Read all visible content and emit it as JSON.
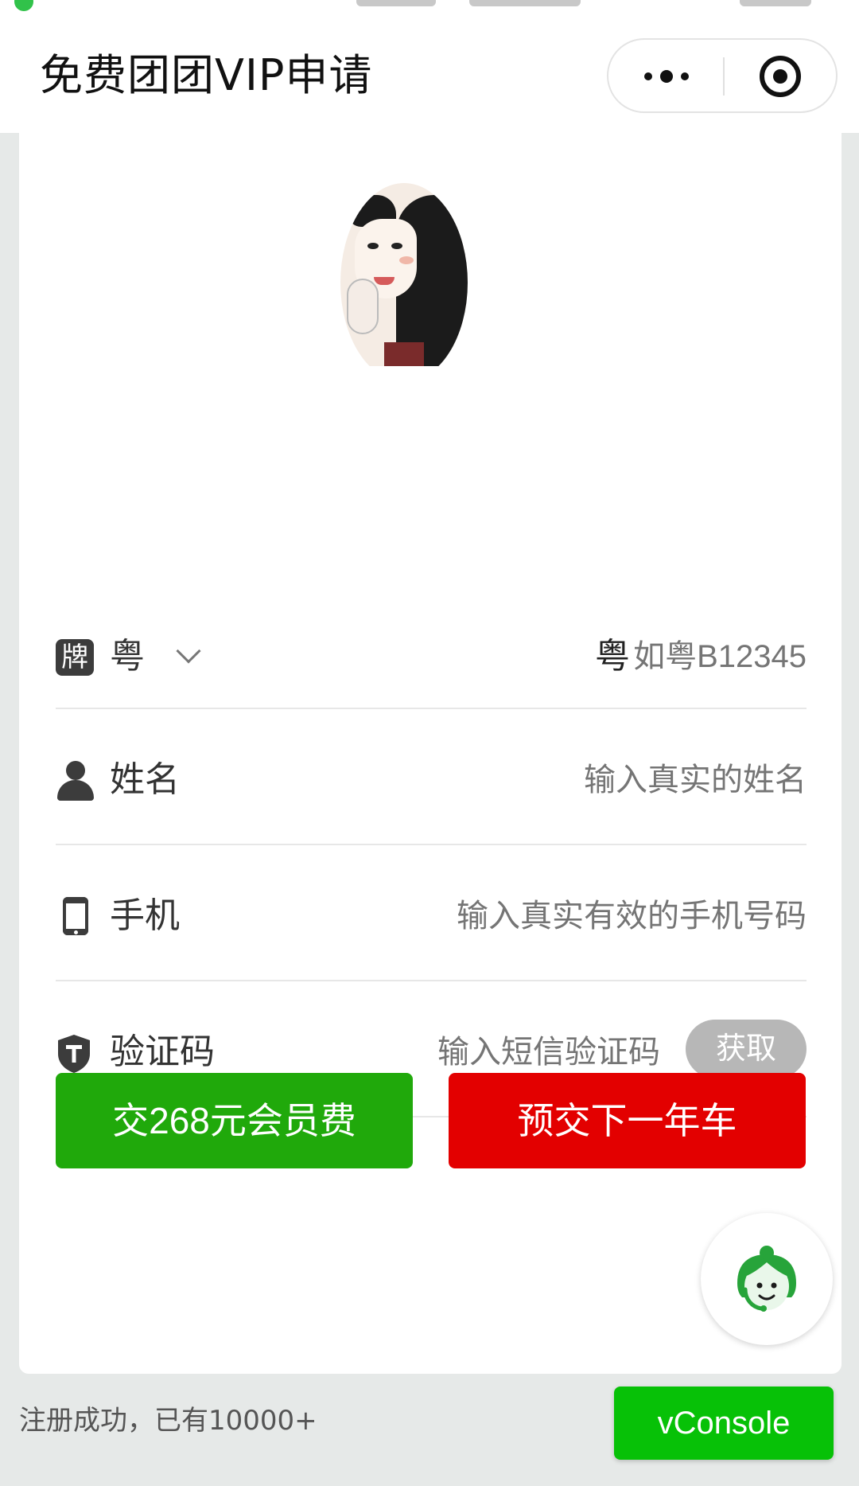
{
  "nav": {
    "title": "免费团团VIP申请",
    "more_icon": "more-dots-icon",
    "close_icon": "close-circle-icon"
  },
  "form": {
    "plate": {
      "icon_text": "牌",
      "province": "粤",
      "prefix": "粤",
      "placeholder": "如粤B12345"
    },
    "name": {
      "label": "姓名",
      "placeholder": "输入真实的姓名",
      "icon": "person-icon"
    },
    "phone": {
      "label": "手机",
      "placeholder": "输入真实有效的手机号码",
      "icon": "phone-icon"
    },
    "code": {
      "label": "验证码",
      "placeholder": "输入短信验证码",
      "button": "获取",
      "icon": "shield-icon"
    }
  },
  "actions": {
    "pay_member": "交268元会员费",
    "prepay_car": "预交下一年车"
  },
  "floating": {
    "icon": "customer-service-icon"
  },
  "footer": {
    "note": "注册成功，已有10000+",
    "vconsole": "vConsole"
  },
  "colors": {
    "green": "#20a90b",
    "red": "#e30000",
    "vconsole": "#07c107",
    "muted_button": "#b7b7b7"
  }
}
